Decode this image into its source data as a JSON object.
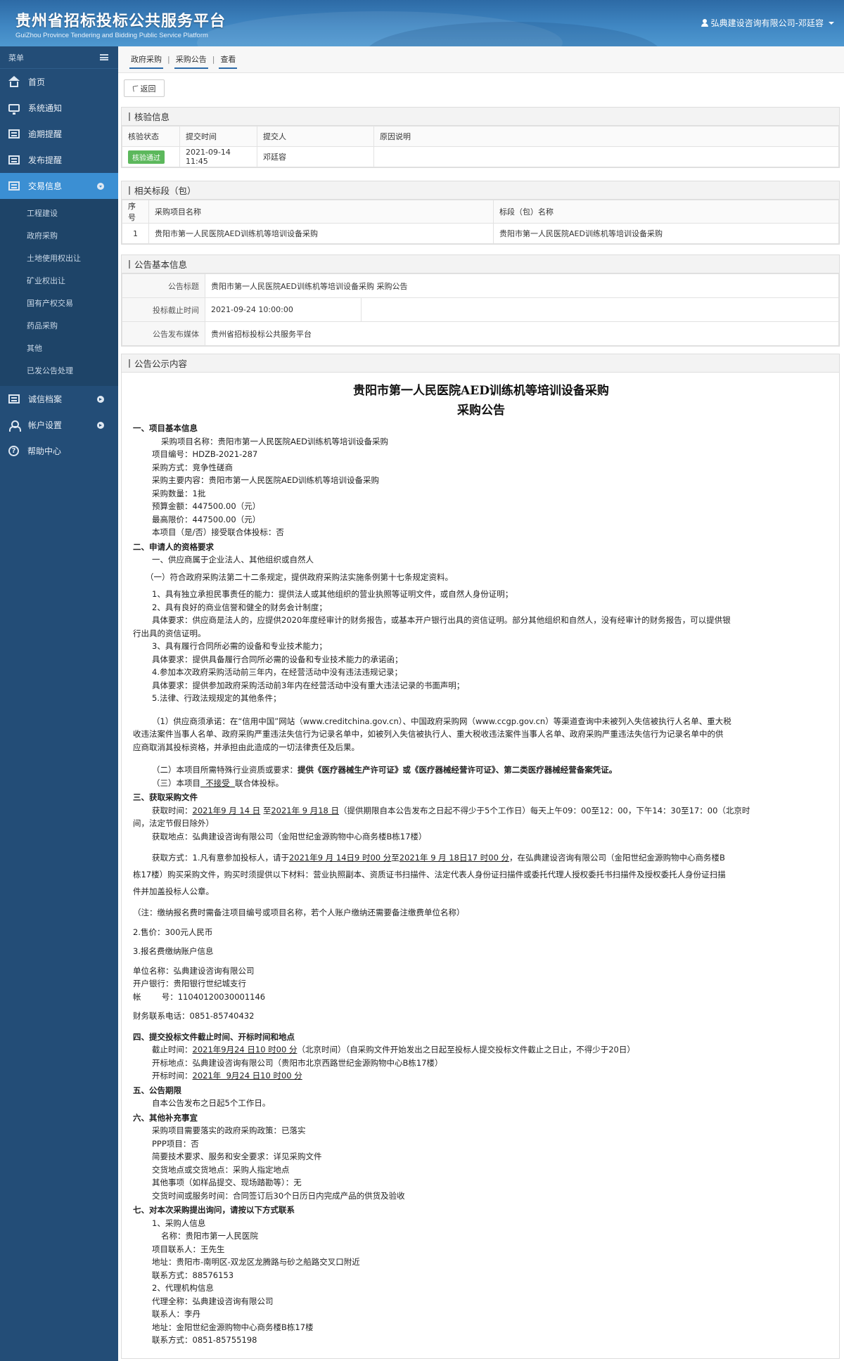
{
  "header": {
    "title": "贵州省招标投标公共服务平台",
    "subtitle": "GuiZhou Province Tendering and Bidding Public Service Platform",
    "user": "弘典建设咨询有限公司-邓廷容"
  },
  "sidebar": {
    "menu_label": "菜单",
    "items": [
      {
        "label": "首页",
        "icon": "home-icon"
      },
      {
        "label": "系统通知",
        "icon": "monitor-icon"
      },
      {
        "label": "逾期提醒",
        "icon": "list-icon"
      },
      {
        "label": "发布提醒",
        "icon": "list-icon"
      },
      {
        "label": "交易信息",
        "icon": "list-icon"
      },
      {
        "label": "诚信档案",
        "icon": "list-icon"
      },
      {
        "label": "帐户设置",
        "icon": "user-icon"
      },
      {
        "label": "帮助中心",
        "icon": "help-icon"
      }
    ],
    "sub_items": [
      "工程建设",
      "政府采购",
      "土地使用权出让",
      "矿业权出让",
      "国有产权交易",
      "药品采购",
      "其他",
      "已发公告处理"
    ]
  },
  "breadcrumb": [
    "政府采购",
    "采购公告",
    "查看"
  ],
  "back_label": "返回",
  "verify": {
    "title": "核验信息",
    "headers": [
      "核验状态",
      "提交时间",
      "提交人",
      "原因说明"
    ],
    "status": "核验通过",
    "time": "2021-09-14 11:45",
    "submitter": "邓廷容",
    "reason": ""
  },
  "sections": {
    "title": "相关标段（包）",
    "headers": [
      "序号",
      "采购项目名称",
      "标段（包）名称"
    ],
    "row": {
      "no": "1",
      "project": "贵阳市第一人民医院AED训练机等培训设备采购",
      "section": "贵阳市第一人民医院AED训练机等培训设备采购"
    }
  },
  "basic": {
    "title": "公告基本信息",
    "title_label": "公告标题",
    "title_value": "贵阳市第一人民医院AED训练机等培训设备采购 采购公告",
    "deadline_label": "投标截止时间",
    "deadline_value": "2021-09-24 10:00:00",
    "media_label": "公告发布媒体",
    "media_value": "贵州省招标投标公共服务平台"
  },
  "content": {
    "title": "公告公示内容",
    "doc_title_1": "贵阳市第一人民医院AED训练机等培训设备采购",
    "doc_title_2": "采购公告",
    "s1": "一、项目基本信息",
    "s1_lines": [
      "采购项目名称：贵阳市第一人民医院AED训练机等培训设备采购",
      "项目编号：HDZB-2021-287",
      "采购方式：竞争性磋商",
      "采购主要内容：贵阳市第一人民医院AED训练机等培训设备采购",
      "采购数量：1批",
      "预算金额：447500.00（元）",
      "最高限价：447500.00（元）",
      "本项目（是/否）接受联合体投标：否"
    ],
    "s2": "二、申请人的资格要求",
    "s2_a": "一、供应商属于企业法人、其他组织或自然人",
    "s2_b": "（一）符合政府采购法第二十二条规定，提供政府采购法实施条例第十七条规定资料。",
    "s2_c1": "1、具有独立承担民事责任的能力：提供法人或其他组织的营业执照等证明文件，或自然人身份证明；",
    "s2_c2": "2、具有良好的商业信誉和健全的财务会计制度；",
    "s2_c3": "具体要求：供应商是法人的，应提供2020年度经审计的财务报告，或基本开户银行出具的资信证明。部分其他组织和自然人，没有经审计的财务报告，可以提供银",
    "s2_c3b": "行出具的资信证明。",
    "s2_c4": "3、具有履行合同所必需的设备和专业技术能力；",
    "s2_c5": "具体要求：提供具备履行合同所必需的设备和专业技术能力的承诺函；",
    "s2_c6": "4.参加本次政府采购活动前三年内，在经营活动中没有违法违规记录；",
    "s2_c7": "具体要求：提供参加政府采购活动前3年内在经营活动中没有重大违法记录的书面声明；",
    "s2_c8": "5.法律、行政法规规定的其他条件；",
    "s2_d1": "（1）供应商须承诺：在“信用中国”网站（www.creditchina.gov.cn）、中国政府采购网（www.ccgp.gov.cn）等渠道查询中未被列入失信被执行人名单、重大税",
    "s2_d2": "收违法案件当事人名单、政府采购严重违法失信行为记录名单中，如被列入失信被执行人、重大税收违法案件当事人名单、政府采购严重违法失信行为记录名单中的供",
    "s2_d3": "应商取消其投标资格，并承担由此造成的一切法律责任及后果。",
    "s2_e_pre": "（二）本项目所需特殊行业资质或要求：",
    "s2_e_bold": "提供《医疗器械生产许可证》或《医疗器械经营许可证》、第二类医疗器械经营备案凭证。",
    "s2_f_pre": "（三）本项目",
    "s2_f_u": "  不接受  ",
    "s2_f_post": "联合体投标。",
    "s3": "三、获取采购文件",
    "s3_a_pre": "获取时间：",
    "s3_a_u1": "2021年9 月 14 日",
    "s3_a_mid": " 至",
    "s3_a_u2": "2021年 9 月18 日",
    "s3_a_post": "（提供期限自本公告发布之日起不得少于5个工作日）每天上午09：00至12：00，下午14：30至17：00（北京时",
    "s3_a2": "间，法定节假日除外）",
    "s3_b": "获取地点：弘典建设咨询有限公司（金阳世纪金源购物中心商务楼B栋17楼）",
    "s3_c_pre": "获取方式：1.凡有意参加投标人，请于",
    "s3_c_u1": "2021年9  月  14日9 时00 分",
    "s3_c_mid": "至",
    "s3_c_u2": "2021年  9  月  18日17 时00 分",
    "s3_c_post": "，在弘典建设咨询有限公司（金阳世纪金源购物中心商务楼B",
    "s3_c2": "栋17楼）购买采购文件，购买时须提供以下材料：营业执照副本、资质证书扫描件、法定代表人身份证扫描件或委托代理人授权委托书扫描件及授权委托人身份证扫描",
    "s3_c3": "件并加盖投标人公章。",
    "s3_note": "（注：缴纳报名费时需备注项目编号或项目名称，若个人账户缴纳还需要备注缴费单位名称）",
    "s3_price": "2.售价：300元人民币",
    "s3_acc": "3.报名费缴纳账户信息",
    "s3_unit": "单位名称：弘典建设咨询有限公司",
    "s3_bank": "开户银行：贵阳银行世纪城支行",
    "s3_no": "帐        号：11040120030001146",
    "s3_tel": "财务联系电话：0851-85740432",
    "s4": "四、提交投标文件截止时间、开标时间和地点",
    "s4_a_pre": "截止时间：",
    "s4_a_u": "2021年9月24 日10 时00 分",
    "s4_a_post": "（北京时间）（自采购文件开始发出之日起至投标人提交投标文件截止之日止，不得少于20日）",
    "s4_b": "开标地点：弘典建设咨询有限公司（贵阳市北京西路世纪金源购物中心B栋17楼）",
    "s4_c_pre": "开标时间：",
    "s4_c_u": "2021年  9月24 日10 时00 分",
    "s5": "五、公告期限",
    "s5_a": "自本公告发布之日起5个工作日。",
    "s6": "六、其他补充事宜",
    "s6_lines": [
      "采购项目需要落实的政府采购政策：已落实",
      "PPP项目：否",
      "简要技术要求、服务和安全要求：详见采购文件",
      "交货地点或交货地点：采购人指定地点",
      "其他事项（如样品提交、现场踏勘等）：无",
      "交货时间或服务时间：合同签订后30个日历日内完成产品的供货及验收"
    ],
    "s7": "七、对本次采购提出询问，请按以下方式联系",
    "s7_a": "1、采购人信息",
    "s7_a1": "名称：贵阳市第一人民医院",
    "s7_a2": "项目联系人：王先生",
    "s7_a3": "地址：贵阳市-南明区-双龙区龙腾路与砂之船路交叉口附近",
    "s7_a4": "联系方式：88576153",
    "s7_b": "2、代理机构信息",
    "s7_b1": "代理全称：弘典建设咨询有限公司",
    "s7_b2": "联系人：李丹",
    "s7_b3": "地址：金阳世纪金源购物中心商务楼B栋17楼",
    "s7_b4": "联系方式：0851-85755198"
  }
}
